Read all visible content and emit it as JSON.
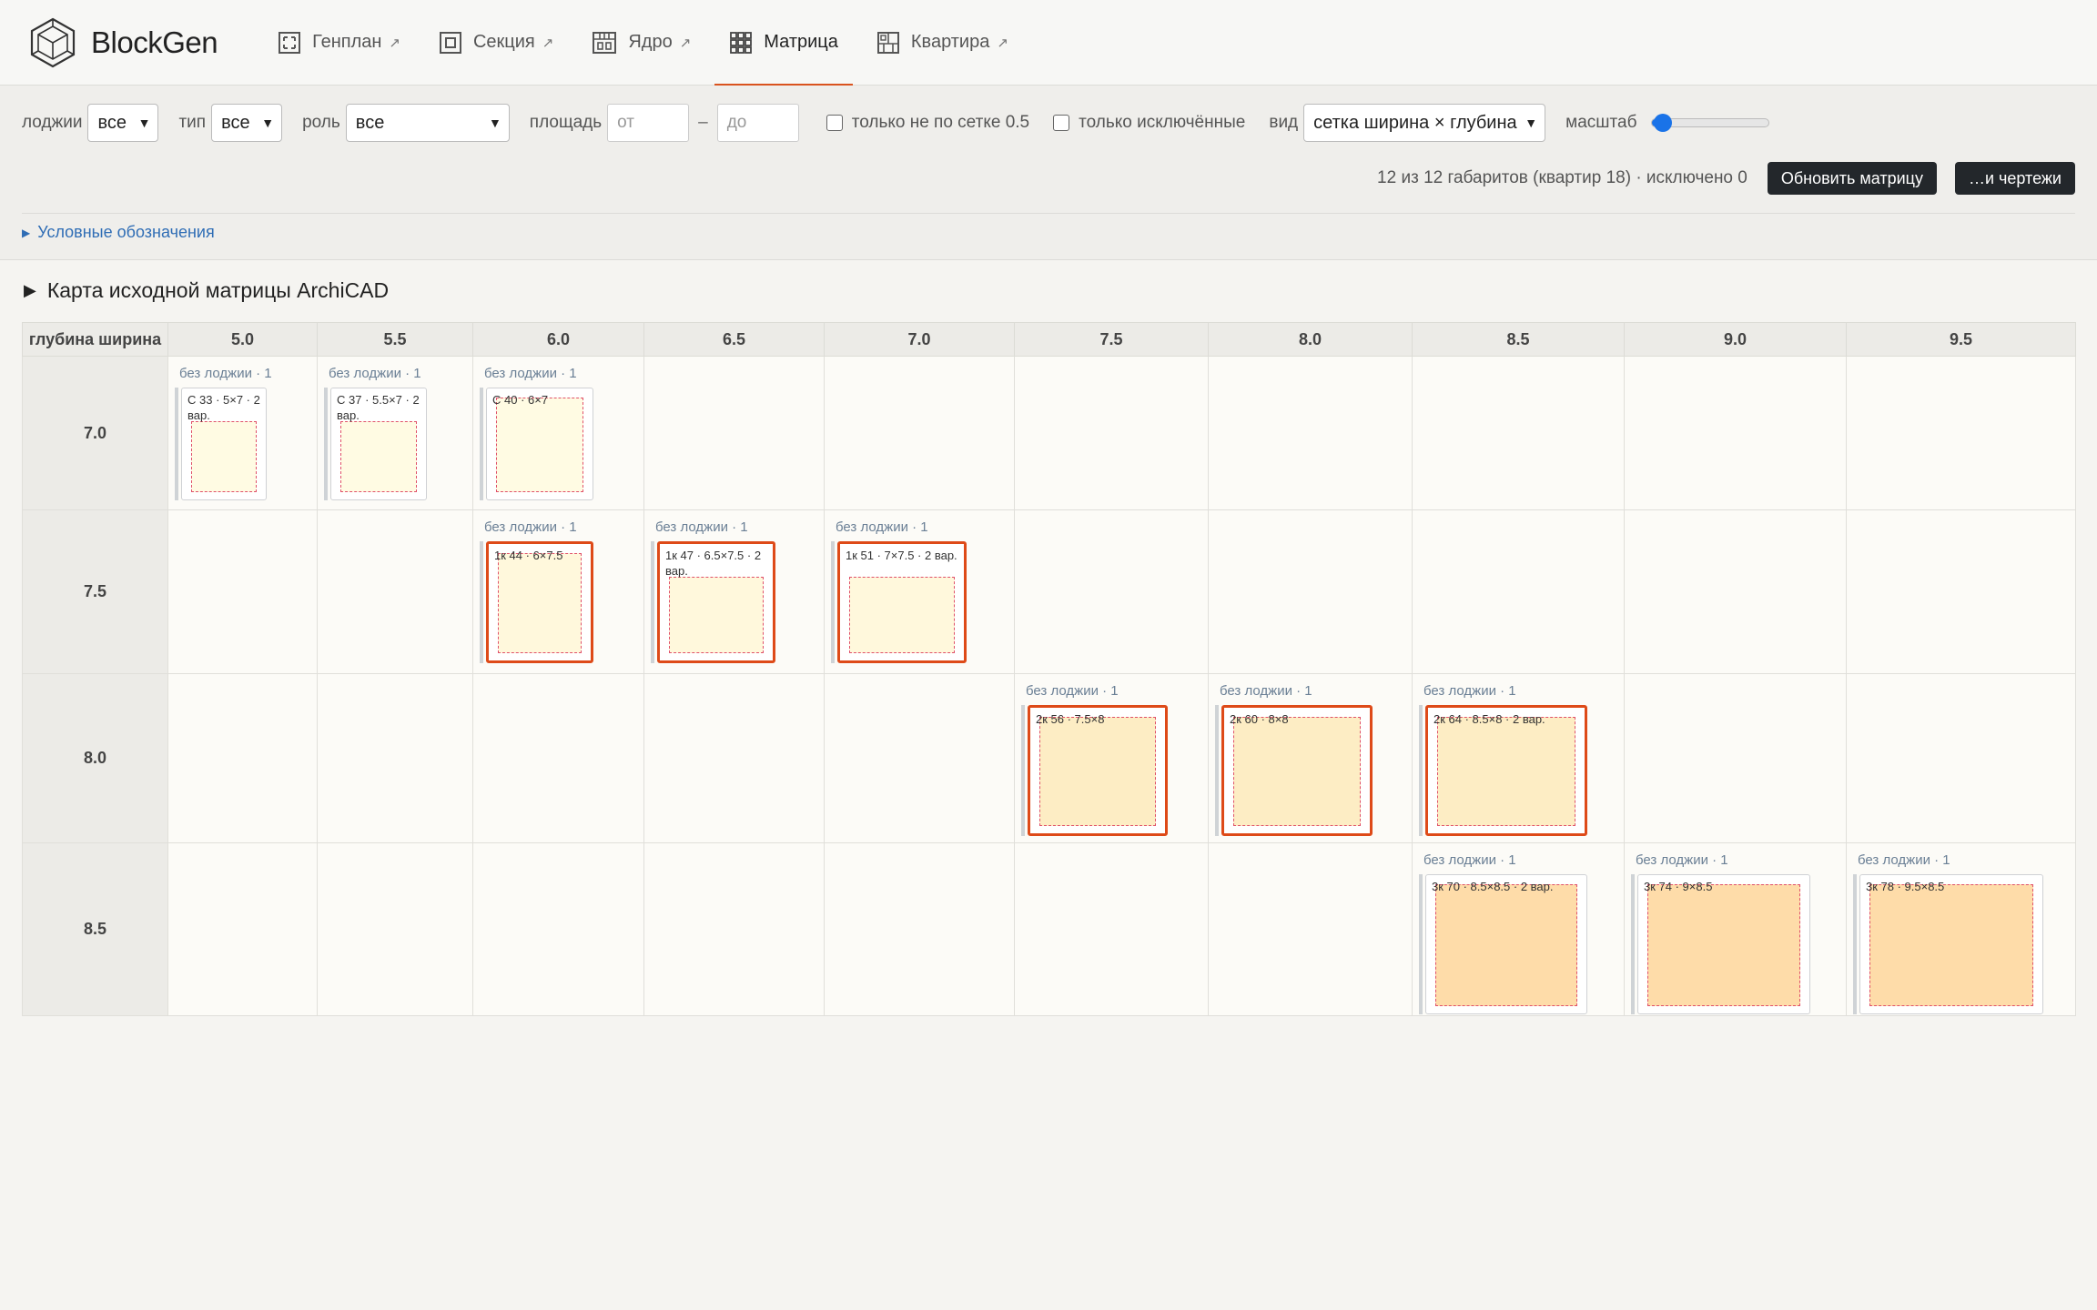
{
  "brand": {
    "name": "BlockGen"
  },
  "nav": [
    {
      "label": "Генплан",
      "icon": "genplan-icon",
      "ext": "↗",
      "active": false
    },
    {
      "label": "Секция",
      "icon": "section-icon",
      "ext": "↗",
      "active": false
    },
    {
      "label": "Ядро",
      "icon": "core-icon",
      "ext": "↗",
      "active": false
    },
    {
      "label": "Матрица",
      "icon": "matrix-icon",
      "ext": "",
      "active": true
    },
    {
      "label": "Квартира",
      "icon": "apartment-icon",
      "ext": "↗",
      "active": false
    }
  ],
  "filters": {
    "loggia_label": "лоджии",
    "loggia_value": "все",
    "type_label": "тип",
    "type_value": "все",
    "role_label": "роль",
    "role_value": "все",
    "area_label": "площадь",
    "area_from_placeholder": "от",
    "area_dash": "–",
    "area_to_placeholder": "до",
    "offgrid_label": "только не по сетке 0.5",
    "excluded_label": "только исключённые",
    "view_label": "вид",
    "view_value": "сетка ширина × глубина",
    "scale_label": "масштаб"
  },
  "status": {
    "text": "12 из 12 габаритов (квартир 18) · исключено 0",
    "update_button": "Обновить матрицу",
    "drawings_button": "…и чертежи"
  },
  "legend": {
    "label": "Условные обозначения"
  },
  "section": {
    "title": "Карта исходной матрицы ArchiCAD"
  },
  "matrix": {
    "corner": "глубина ширина",
    "widths": [
      "5.0",
      "5.5",
      "6.0",
      "6.5",
      "7.0",
      "7.5",
      "8.0",
      "8.5",
      "9.0",
      "9.5"
    ],
    "depths": [
      "7.0",
      "7.5",
      "8.0",
      "8.5"
    ],
    "cells": [
      {
        "row": 0,
        "col": 0,
        "caption": "без лоджии · 1",
        "label": "С 33 · 5×7 · 2 вар.",
        "selected": false,
        "fill": "#fffbe3"
      },
      {
        "row": 0,
        "col": 1,
        "caption": "без лоджии · 1",
        "label": "С 37 · 5.5×7 · 2 вар.",
        "selected": false,
        "fill": "#fffbe3"
      },
      {
        "row": 0,
        "col": 2,
        "caption": "без лоджии · 1",
        "label": "С 40 · 6×7",
        "selected": false,
        "fill": "#fffbe3"
      },
      {
        "row": 1,
        "col": 2,
        "caption": "без лоджии · 1",
        "label": "1к 44 · 6×7.5",
        "selected": true,
        "fill": "#fff8dc"
      },
      {
        "row": 1,
        "col": 3,
        "caption": "без лоджии · 1",
        "label": "1к 47 · 6.5×7.5 · 2 вар.",
        "selected": true,
        "fill": "#fff8dc"
      },
      {
        "row": 1,
        "col": 4,
        "caption": "без лоджии · 1",
        "label": "1к 51 · 7×7.5 · 2 вар.",
        "selected": true,
        "fill": "#fff8dc"
      },
      {
        "row": 2,
        "col": 5,
        "caption": "без лоджии · 1",
        "label": "2к 56 · 7.5×8",
        "selected": true,
        "fill": "#fdedc4"
      },
      {
        "row": 2,
        "col": 6,
        "caption": "без лоджии · 1",
        "label": "2к 60 · 8×8",
        "selected": true,
        "fill": "#fdedc4"
      },
      {
        "row": 2,
        "col": 7,
        "caption": "без лоджии · 1",
        "label": "2к 64 · 8.5×8 · 2 вар.",
        "selected": true,
        "fill": "#fdedc4"
      },
      {
        "row": 3,
        "col": 7,
        "caption": "без лоджии · 1",
        "label": "3к 70 · 8.5×8.5 · 2 вар.",
        "selected": false,
        "fill": "#fedca9"
      },
      {
        "row": 3,
        "col": 8,
        "caption": "без лоджии · 1",
        "label": "3к 74 · 9×8.5",
        "selected": false,
        "fill": "#fedca9"
      },
      {
        "row": 3,
        "col": 9,
        "caption": "без лоджии · 1",
        "label": "3к 78 · 9.5×8.5",
        "selected": false,
        "fill": "#fedca9"
      }
    ]
  },
  "colors": {
    "accent": "#d9531e",
    "link": "#2f6db5",
    "button": "#23272b"
  }
}
